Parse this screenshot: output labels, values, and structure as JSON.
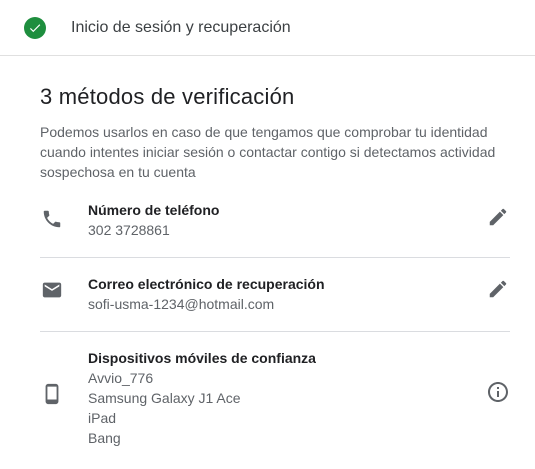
{
  "header": {
    "title": "Inicio de sesión y recuperación",
    "status_icon": "check-circle-icon",
    "status_color": "#1e8e3e"
  },
  "main": {
    "title": "3 métodos de verificación",
    "description": "Podemos usarlos en caso de que tengamos que comprobar tu identidad cuando intentes iniciar sesión o contactar contigo si detectamos actividad sospechosa en tu cuenta"
  },
  "methods": [
    {
      "icon": "phone-icon",
      "label": "Número de teléfono",
      "values": [
        "302 3728861"
      ],
      "action_icon": "edit-icon"
    },
    {
      "icon": "email-icon",
      "label": "Correo electrónico de recuperación",
      "values": [
        "sofi-usma-1234@hotmail.com"
      ],
      "action_icon": "edit-icon"
    },
    {
      "icon": "smartphone-icon",
      "label": "Dispositivos móviles de confianza",
      "values": [
        "Avvio_776",
        "Samsung Galaxy J1 Ace",
        "iPad",
        "Bang"
      ],
      "action_icon": "info-icon"
    }
  ],
  "colors": {
    "icon_gray": "#5f6368",
    "divider": "#dadce0"
  }
}
